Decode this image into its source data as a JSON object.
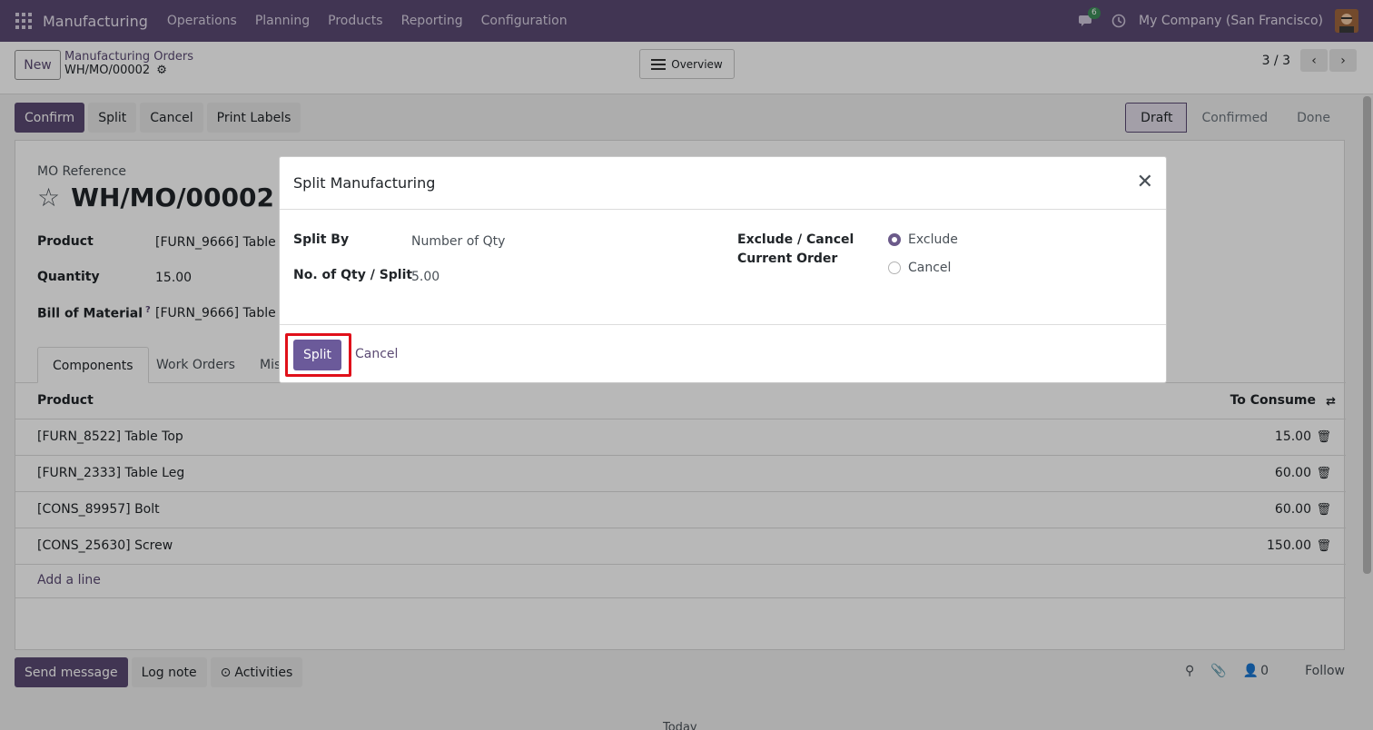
{
  "navbar": {
    "brand": "Manufacturing",
    "menu": [
      "Operations",
      "Planning",
      "Products",
      "Reporting",
      "Configuration"
    ],
    "chat_count": "6",
    "company": "My Company (San Francisco)"
  },
  "control": {
    "new_label": "New",
    "breadcrumb_parent": "Manufacturing Orders",
    "breadcrumb_current": "WH/MO/00002",
    "overview_label": "Overview",
    "pager": "3 / 3"
  },
  "actions": [
    "Confirm",
    "Split",
    "Cancel",
    "Print Labels"
  ],
  "status_stages": [
    "Draft",
    "Confirmed",
    "Done"
  ],
  "form": {
    "mo_label": "MO Reference",
    "mo_name": "WH/MO/00002",
    "product_label": "Product",
    "product_value": "[FURN_9666] Table",
    "quantity_label": "Quantity",
    "quantity_value": "15.00",
    "bom_label": "Bill of Material",
    "bom_help": "?",
    "bom_value": "[FURN_9666] Table"
  },
  "tabs": [
    "Components",
    "Work Orders",
    "Mis"
  ],
  "table": {
    "col_product": "Product",
    "col_consume": "To Consume",
    "rows": [
      {
        "product": "[FURN_8522] Table Top",
        "qty": "15.00"
      },
      {
        "product": "[FURN_2333] Table Leg",
        "qty": "60.00"
      },
      {
        "product": "[CONS_89957] Bolt",
        "qty": "60.00"
      },
      {
        "product": "[CONS_25630] Screw",
        "qty": "150.00"
      }
    ],
    "add_line": "Add a line"
  },
  "chatter": {
    "send_message": "Send message",
    "log_note": "Log note",
    "activities": "Activities",
    "followers": "0",
    "follow": "Follow",
    "today": "Today"
  },
  "modal": {
    "title": "Split Manufacturing",
    "split_by_label": "Split By",
    "split_by_value": "Number of Qty",
    "qty_label": "No. of Qty / Split",
    "qty_value": "5.00",
    "exclude_label_1": "Exclude / Cancel",
    "exclude_label_2": "Current Order",
    "option_exclude": "Exclude",
    "option_cancel": "Cancel",
    "split_button": "Split",
    "cancel_button": "Cancel"
  },
  "colors": {
    "brand": "#5b4a73",
    "highlight": "#e0101a"
  }
}
